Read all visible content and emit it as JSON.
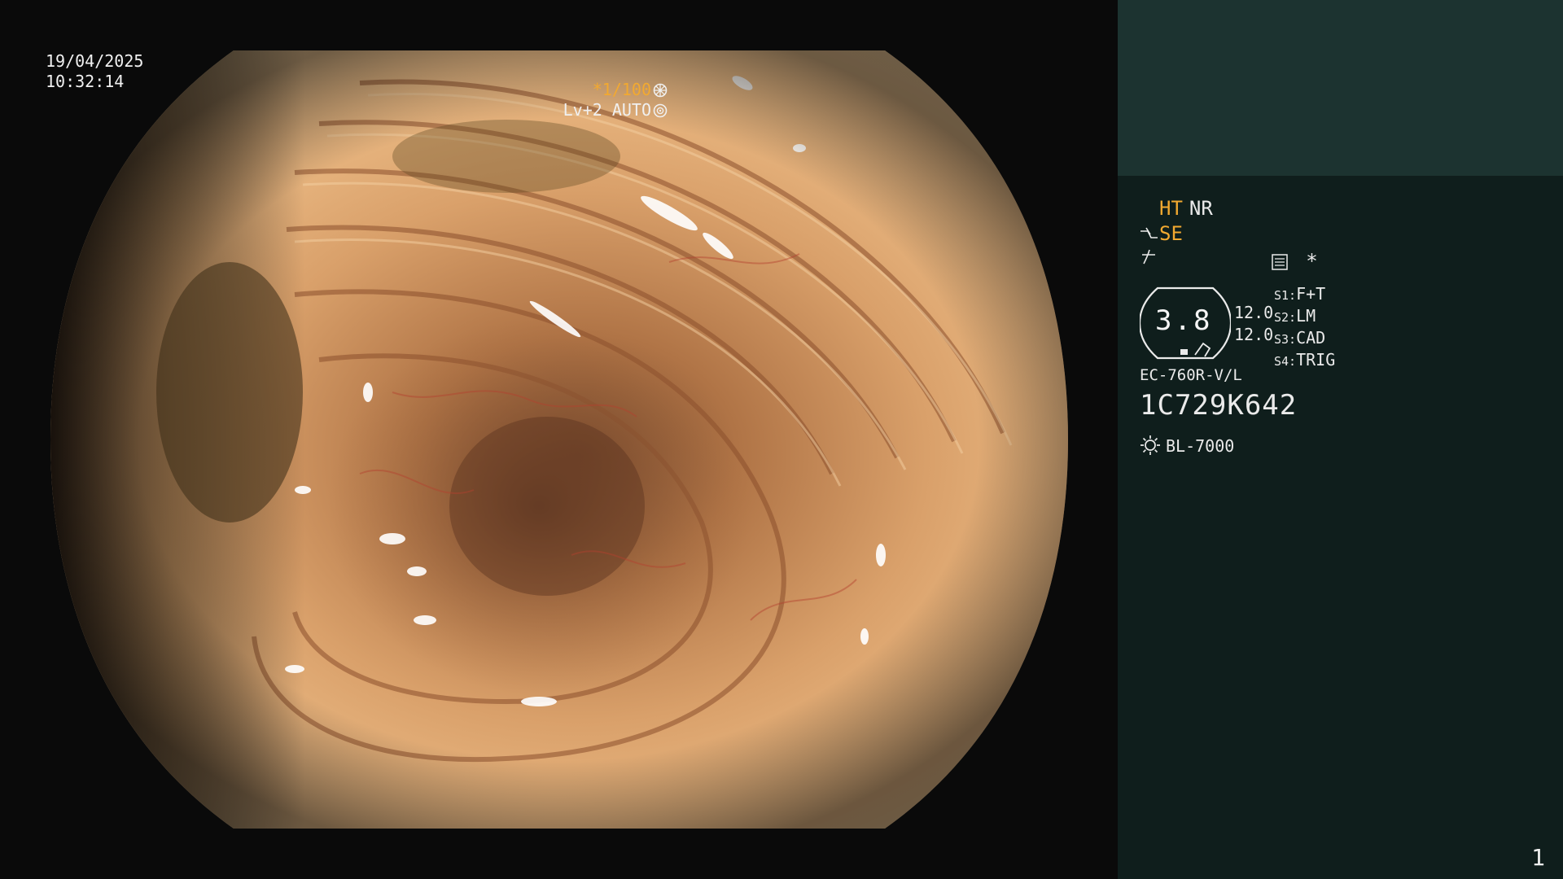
{
  "overlay": {
    "date": "19/04/2025",
    "time": "10:32:14",
    "shutter_prefix": "*",
    "shutter_value": "1/100",
    "level": "Lv+2",
    "mode": "AUTO"
  },
  "panel": {
    "ht": "HT",
    "nr": "NR",
    "se": "SE",
    "magnification": "3.8",
    "value_1": "12.0",
    "value_2": "12.0",
    "switches": [
      {
        "key": "S1:",
        "value": "F+T"
      },
      {
        "key": "S2:",
        "value": "LM"
      },
      {
        "key": "S3:",
        "value": "CAD"
      },
      {
        "key": "S4:",
        "value": "TRIG"
      }
    ],
    "asterisk": "*",
    "scope_model": "EC-760R-V/L",
    "serial": "1C729K642",
    "light_source": "BL-7000",
    "page_number": "1"
  },
  "colors": {
    "accent_orange": "#f2a930",
    "panel_bg": "#0f1e1c",
    "panel_top_bg": "#1c3330"
  },
  "icons": [
    "shutter-icon",
    "iris-icon",
    "scope-icon",
    "edge-icon",
    "menu-icon",
    "light-source-icon"
  ]
}
